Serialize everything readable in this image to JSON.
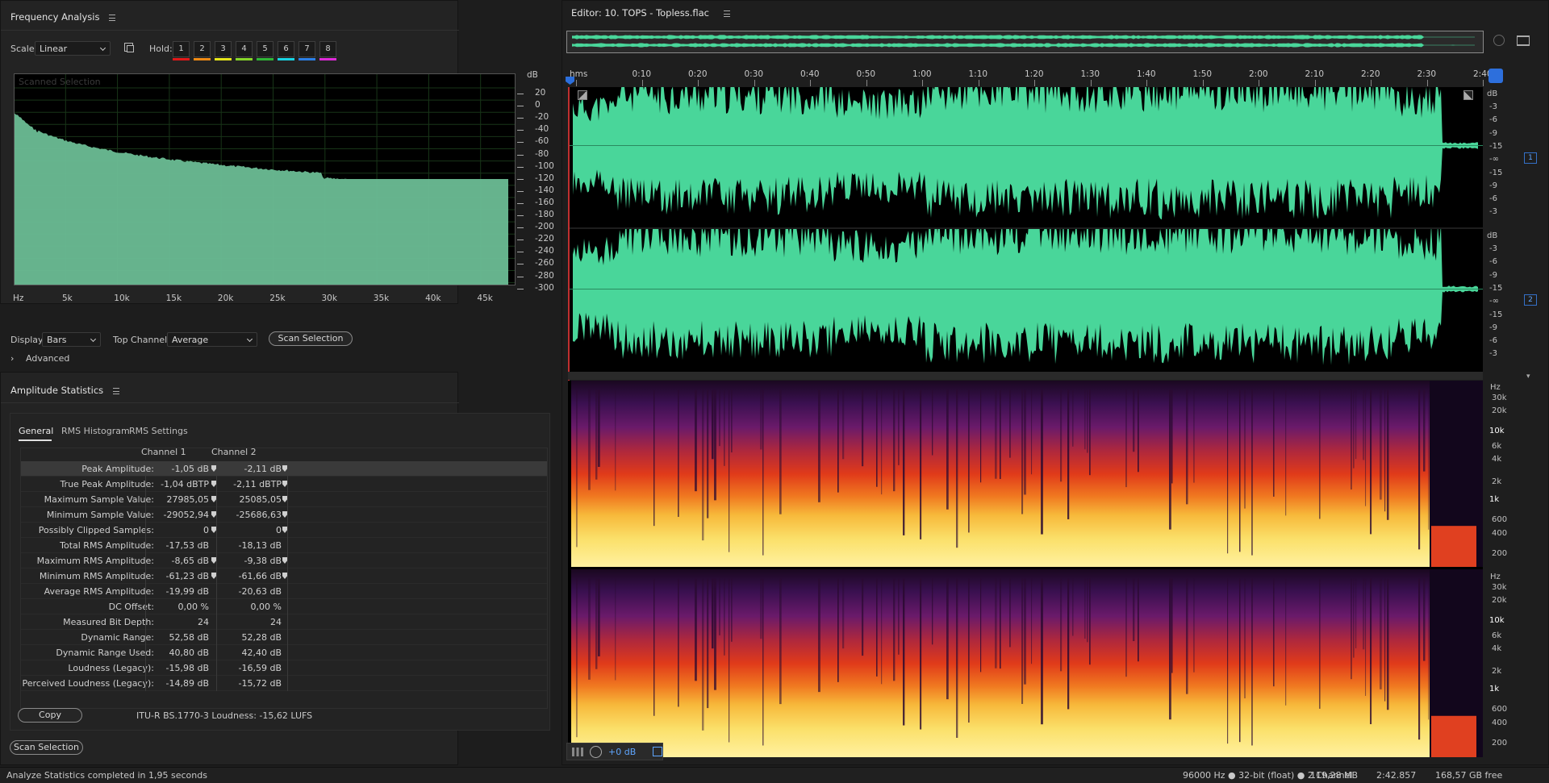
{
  "freq": {
    "title": "Frequency Analysis",
    "scale_label": "Scale:",
    "scale_value": "Linear",
    "hold_label": "Hold:",
    "hold_buttons": [
      "1",
      "2",
      "3",
      "4",
      "5",
      "6",
      "7",
      "8"
    ],
    "hold_colors": [
      "#e11919",
      "#ef8a14",
      "#e6e61a",
      "#86d62a",
      "#2fb536",
      "#18d4e3",
      "#2b7fe6",
      "#de2ad8"
    ],
    "graph_label": "Scanned Selection",
    "y_unit": "dB",
    "y_ticks": [
      "20",
      "0",
      "-20",
      "-40",
      "-60",
      "-80",
      "-100",
      "-120",
      "-140",
      "-160",
      "-180",
      "-200",
      "-220",
      "-240",
      "-260",
      "-280",
      "-300"
    ],
    "x_ticks": [
      "Hz",
      "5k",
      "10k",
      "15k",
      "20k",
      "25k",
      "30k",
      "35k",
      "40k",
      "45k"
    ],
    "display_label": "Display:",
    "display_value": "Bars",
    "top_channel_label": "Top Channel:",
    "top_channel_value": "Average",
    "scan_button": "Scan Selection",
    "advanced_label": "Advanced",
    "fill_color": "#6bbd95"
  },
  "stats": {
    "title": "Amplitude Statistics",
    "tabs": [
      "General",
      "RMS Histogram",
      "RMS Settings"
    ],
    "active_tab": 0,
    "col_headers": [
      "Channel 1",
      "Channel 2"
    ],
    "rows": [
      {
        "label": "Peak Amplitude:",
        "c1": "-1,05 dB",
        "c2": "-2,11 dB"
      },
      {
        "label": "True Peak Amplitude:",
        "c1": "-1,04 dBTP",
        "c2": "-2,11 dBTP"
      },
      {
        "label": "Maximum Sample Value:",
        "c1": "27985,05",
        "c2": "25085,05"
      },
      {
        "label": "Minimum Sample Value:",
        "c1": "-29052,94",
        "c2": "-25686,63"
      },
      {
        "label": "Possibly Clipped Samples:",
        "c1": "0",
        "c2": "0"
      },
      {
        "label": "Total RMS Amplitude:",
        "c1": "-17,53 dB",
        "c2": "-18,13 dB"
      },
      {
        "label": "Maximum RMS Amplitude:",
        "c1": "-8,65 dB",
        "c2": "-9,38 dB"
      },
      {
        "label": "Minimum RMS Amplitude:",
        "c1": "-61,23 dB",
        "c2": "-61,66 dB"
      },
      {
        "label": "Average RMS Amplitude:",
        "c1": "-19,99 dB",
        "c2": "-20,63 dB"
      },
      {
        "label": "DC Offset:",
        "c1": "0,00 %",
        "c2": "0,00 %"
      },
      {
        "label": "Measured Bit Depth:",
        "c1": "24",
        "c2": "24"
      },
      {
        "label": "Dynamic Range:",
        "c1": "52,58 dB",
        "c2": "52,28 dB"
      },
      {
        "label": "Dynamic Range Used:",
        "c1": "40,80 dB",
        "c2": "42,40 dB"
      },
      {
        "label": "Loudness (Legacy):",
        "c1": "-15,98 dB",
        "c2": "-16,59 dB"
      },
      {
        "label": "Perceived Loudness (Legacy):",
        "c1": "-14,89 dB",
        "c2": "-15,72 dB"
      }
    ],
    "copy_button": "Copy",
    "loudness_text": "ITU-R BS.1770-3 Loudness: -15,62 LUFS",
    "scan_button": "Scan Selection"
  },
  "editor": {
    "title": "Editor: 10. TOPS - Topless.flac",
    "time_ticks": [
      "hms",
      "0:10",
      "0:20",
      "0:30",
      "0:40",
      "0:50",
      "1:00",
      "1:10",
      "1:20",
      "1:30",
      "1:40",
      "1:50",
      "2:00",
      "2:10",
      "2:20",
      "2:30",
      "2:40"
    ],
    "db_unit": "dB",
    "db_scale": [
      "-3",
      "-6",
      "-9",
      "-15",
      "-∞",
      "-15",
      "-9",
      "-6",
      "-3"
    ],
    "channel_badges": [
      "1",
      "2"
    ],
    "hz_unit": "Hz",
    "hz_scale": [
      "30k",
      "20k",
      "10k",
      "6k",
      "4k",
      "2k",
      "1k",
      "600",
      "400",
      "200"
    ],
    "gain_value": "+0 dB",
    "wave_color": "#49d69a"
  },
  "status": {
    "message": "Analyze Statistics completed in 1,95 seconds",
    "sample_info": "96000 Hz ● 32-bit (float) ● 2 Channel",
    "file_size": "119,28 MB",
    "duration": "2:42.857",
    "free_space": "168,57 GB free"
  }
}
